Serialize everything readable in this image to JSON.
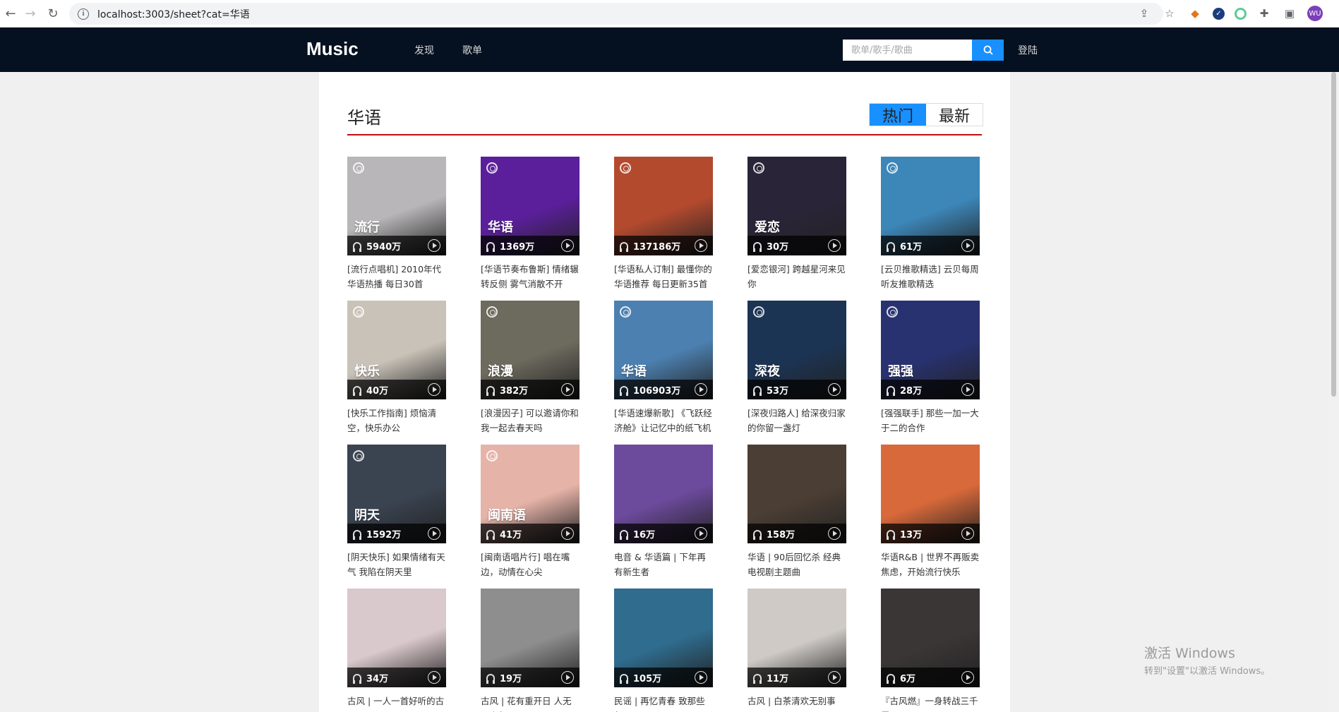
{
  "browser": {
    "url": "localhost:3003/sheet?cat=华语",
    "avatar_text": "WU"
  },
  "header": {
    "logo": "Music",
    "nav": [
      "发现",
      "歌单"
    ],
    "search_placeholder": "歌单/歌手/歌曲",
    "login": "登陆"
  },
  "category": {
    "title": "华语",
    "tabs": [
      "热门",
      "最新"
    ],
    "active_tab": "热门"
  },
  "playlists": [
    {
      "tag": "流行",
      "plays": "5940万",
      "title": "[流行点唱机] 2010年代华语热播 每日30首",
      "color": "#b8b6b8",
      "logo": true
    },
    {
      "tag": "华语",
      "plays": "1369万",
      "title": "[华语节奏布鲁斯] 情绪辗转反侧 雾气消散不开",
      "color": "#5b1f9c",
      "logo": true
    },
    {
      "tag": "",
      "plays": "137186万",
      "title": "[华语私人订制] 最懂你的华语推荐 每日更新35首",
      "color": "#b34a2e",
      "logo": true
    },
    {
      "tag": "爱恋",
      "plays": "30万",
      "title": "[爱恋银河] 跨越星河来见你",
      "color": "#2a2438",
      "logo": true
    },
    {
      "tag": "",
      "plays": "61万",
      "title": "[云贝推歌精选] 云贝每周听友推歌精选",
      "color": "#3c86b8",
      "logo": true
    },
    {
      "tag": "快乐",
      "plays": "40万",
      "title": "[快乐工作指南] 烦恼清空，快乐办公",
      "color": "#c9c2b8",
      "logo": true
    },
    {
      "tag": "浪漫",
      "plays": "382万",
      "title": "[浪漫因子] 可以邀请你和我一起去春天吗",
      "color": "#6d6a5e",
      "logo": true
    },
    {
      "tag": "华语",
      "plays": "106903万",
      "title": "[华语速爆新歌] 《飞跃经济舱》让记忆中的纸飞机飞到你心中",
      "color": "#4c80b0",
      "logo": true
    },
    {
      "tag": "深夜",
      "plays": "53万",
      "title": "[深夜归路人] 给深夜归家的你留一盏灯",
      "color": "#1c3454",
      "logo": true
    },
    {
      "tag": "强强",
      "plays": "28万",
      "title": "[强强联手] 那些一加一大于二的合作",
      "color": "#283270",
      "logo": true
    },
    {
      "tag": "阴天",
      "plays": "1592万",
      "title": "[阴天快乐] 如果情绪有天气 我陷在阴天里",
      "color": "#3a4350",
      "logo": true
    },
    {
      "tag": "闽南语",
      "plays": "41万",
      "title": "[闽南语唱片行] 唱在嘴边，动情在心尖",
      "color": "#e6b3a8",
      "logo": true
    },
    {
      "tag": "",
      "plays": "16万",
      "title": "电音 & 华语篇 | 下年再有新生者",
      "color": "#6c4a9c",
      "logo": false
    },
    {
      "tag": "",
      "plays": "158万",
      "title": "华语 | 90后回忆杀 经典电视剧主题曲",
      "color": "#4b3e34",
      "logo": false
    },
    {
      "tag": "",
      "plays": "13万",
      "title": "华语R&B | 世界不再贩卖焦虑，开始流行快乐",
      "color": "#d8693a",
      "logo": false
    },
    {
      "tag": "",
      "plays": "34万",
      "title": "古风 | 一人一首好听的古风",
      "color": "#d9c8cc",
      "logo": false
    },
    {
      "tag": "",
      "plays": "19万",
      "title": "古风 | 花有重开日 人无再少年",
      "color": "#8e8e8e",
      "logo": false
    },
    {
      "tag": "",
      "plays": "105万",
      "title": "民谣 | 再忆青春 致那些年",
      "color": "#2f6c8e",
      "logo": false
    },
    {
      "tag": "",
      "plays": "11万",
      "title": "古风 | 白茶清欢无别事",
      "color": "#cfcac6",
      "logo": false
    },
    {
      "tag": "",
      "plays": "6万",
      "title": "『古风燃』一身转战三千里",
      "color": "#3a3636",
      "logo": false
    }
  ],
  "watermark": {
    "line1": "激活 Windows",
    "line2": "转到\"设置\"以激活 Windows。"
  }
}
